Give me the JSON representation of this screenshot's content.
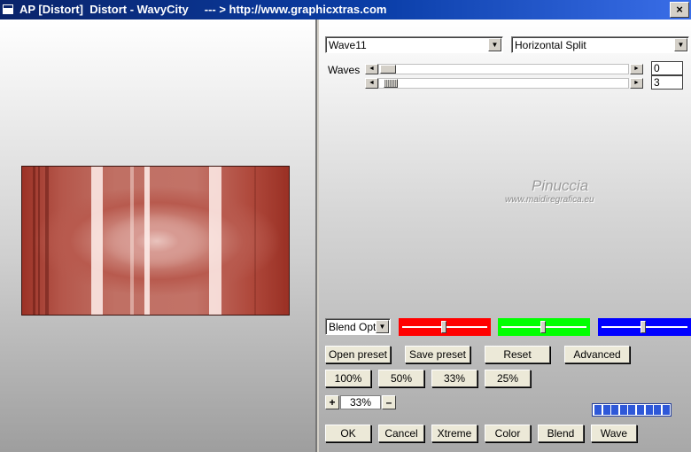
{
  "window": {
    "title": "AP [Distort]  Distort - WavyCity     --- > http://www.graphicxtras.com"
  },
  "controls": {
    "preset_select": "Wave11",
    "mode_select": "Horizontal Split",
    "waves_label": "Waves",
    "slider1_value": "0",
    "slider2_value": "3",
    "blend_select": "Blend Optio",
    "zoom_value": "33%",
    "zoom_plus": "+",
    "zoom_minus": "–"
  },
  "colors": {
    "red": "#ff0000",
    "green": "#00ff00",
    "blue": "#0000ff"
  },
  "buttons": {
    "open_preset": "Open preset",
    "save_preset": "Save preset",
    "reset": "Reset",
    "advanced": "Advanced",
    "z100": "100%",
    "z50": "50%",
    "z33": "33%",
    "z25": "25%",
    "ok": "OK",
    "cancel": "Cancel",
    "xtreme": "Xtreme",
    "color": "Color",
    "blend": "Blend",
    "wave": "Wave"
  },
  "watermark": {
    "name": "Pinuccia",
    "site": "www.maidiregrafica.eu"
  },
  "progress": {
    "filled_segments": 9,
    "total_segments": 9
  }
}
